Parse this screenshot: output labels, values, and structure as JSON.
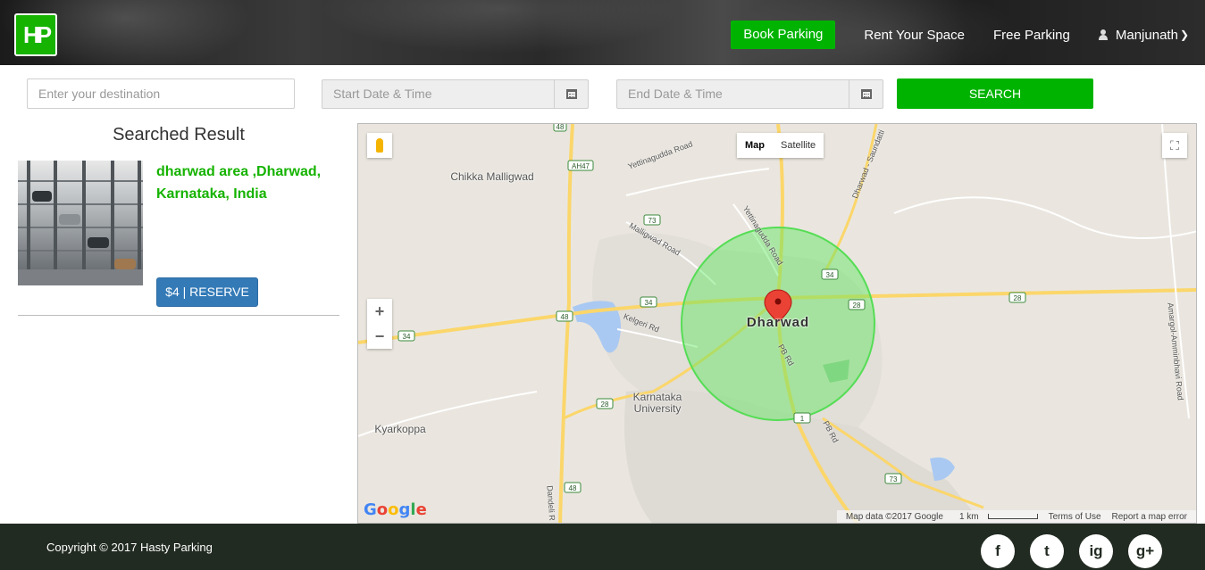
{
  "header": {
    "logo_text": "HP",
    "nav": {
      "book_parking": "Book Parking",
      "rent_space": "Rent Your Space",
      "free_parking": "Free Parking",
      "user_name": "Manjunath"
    }
  },
  "search": {
    "destination_placeholder": "Enter your destination",
    "start_placeholder": "Start Date & Time",
    "end_placeholder": "End Date & Time",
    "button_label": "SEARCH"
  },
  "results": {
    "title": "Searched Result",
    "items": [
      {
        "address": "dharwad area ,Dharwad, Karnataka, India",
        "reserve_label": "$4 | RESERVE"
      }
    ]
  },
  "map": {
    "type_toggle": [
      "Map",
      "Satellite"
    ],
    "zoom_in": "+",
    "zoom_out": "−",
    "places": {
      "city": "Dharwad",
      "chikka": "Chikka Malligwad",
      "university": "Karnataka University",
      "kyarkoppa": "Kyarkoppa"
    },
    "roads": {
      "yettinagudda": "Yettinagudda Road",
      "yettinagudda2": "Yettinagudda Road",
      "malligwad": "Malligwad Road",
      "kelgeri": "Kelgeri Rd",
      "pb_rd": "PB Rd",
      "pb_rd2": "PB Rd",
      "saundatti": "Dharwad - Saundatti",
      "amargol": "Amargol-Amminbhavi Road",
      "dandeli": "Dandeli R"
    },
    "shields": [
      "48",
      "AH47",
      "73",
      "34",
      "28",
      "1",
      "34",
      "28",
      "28",
      "48",
      "1",
      "73",
      "28"
    ],
    "google_logo": "Google",
    "attribution": {
      "map_data": "Map data ©2017 Google",
      "scale": "1 km",
      "terms": "Terms of Use",
      "report": "Report a map error"
    }
  },
  "footer": {
    "copyright": "Copyright © 2017 Hasty Parking",
    "social": [
      "f",
      "t",
      "ig",
      "g+"
    ]
  },
  "colors": {
    "brand_green": "#00b300",
    "reserve_blue": "#337ab7",
    "footer_bg": "#222b22"
  }
}
